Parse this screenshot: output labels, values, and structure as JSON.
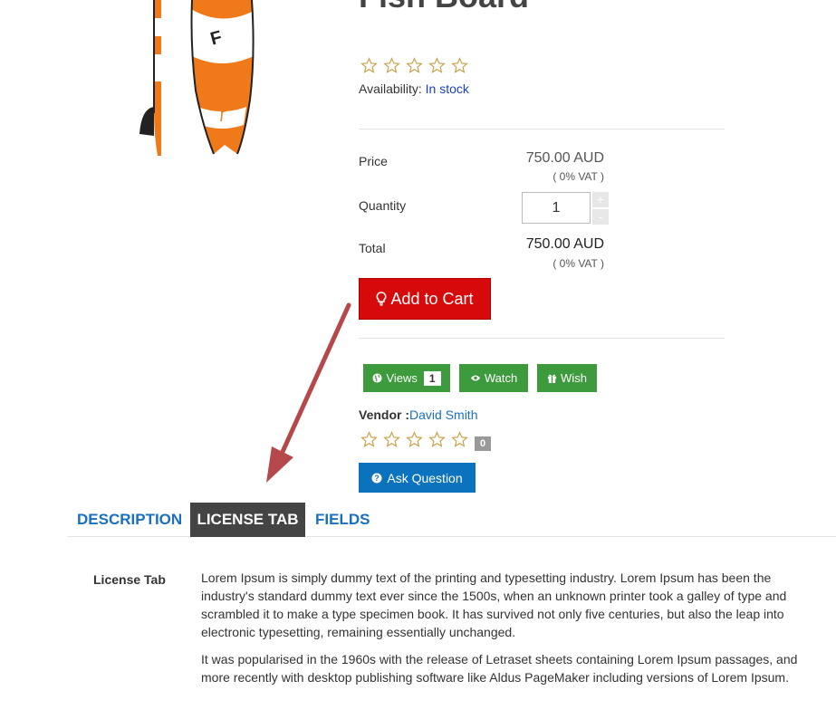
{
  "product": {
    "title": "Fish Board",
    "availability_label": "Availability:",
    "availability_value": "In stock",
    "rating": 0,
    "rating_max": 5
  },
  "pricing": {
    "price_label": "Price",
    "price_value": "750.00 AUD",
    "price_vat": "( 0% VAT )",
    "quantity_label": "Quantity",
    "quantity_value": "1",
    "plus_label": "+",
    "minus_label": "-",
    "total_label": "Total",
    "total_value": "750.00 AUD",
    "total_vat": "( 0% VAT )"
  },
  "actions": {
    "add_to_cart": "Add to Cart",
    "views_label": "Views",
    "views_count": "1",
    "watch_label": "Watch",
    "wish_label": "Wish",
    "ask_question": "Ask Question"
  },
  "vendor": {
    "label": "Vendor :",
    "name": "David Smith",
    "rating": 0,
    "rating_count": "0"
  },
  "tabs": [
    {
      "label": "DESCRIPTION",
      "active": false
    },
    {
      "label": "LICENSE TAB",
      "active": true
    },
    {
      "label": "FIELDS",
      "active": false
    }
  ],
  "tab_content": {
    "label": "License Tab",
    "paragraphs": [
      "Lorem Ipsum is simply dummy text of the printing and typesetting industry. Lorem Ipsum has been the industry's standard dummy text ever since the 1500s, when an unknown printer took a galley of type and scrambled it to make a type specimen book. It has survived not only five centuries, but also the leap into electronic typesetting, remaining essentially unchanged.",
      "It was popularised in the 1960s with the release of Letraset sheets containing Lorem Ipsum passages, and more recently with desktop publishing software like Aldus PageMaker including versions of Lorem Ipsum."
    ]
  },
  "colors": {
    "add_to_cart": "#d60a0a",
    "green_buttons": "#3d9a3d",
    "ask_question": "#0b72bd",
    "active_tab": "#444444",
    "link": "#1a6fbf",
    "star_outline": "#c8a24a",
    "arrow": "#b5484a"
  }
}
